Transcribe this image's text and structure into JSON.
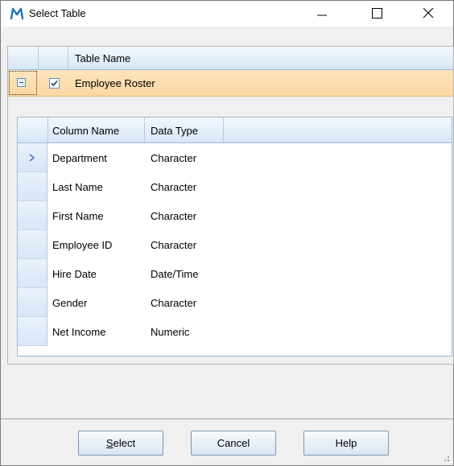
{
  "window": {
    "title": "Select Table",
    "app_icon": "letter-m-icon",
    "controls": [
      "minimize-icon",
      "maximize-icon",
      "close-icon"
    ]
  },
  "grid": {
    "header": {
      "col_label": "Table Name"
    },
    "master_row": {
      "name": "Employee Roster",
      "checked": true,
      "expanded": true
    },
    "detail": {
      "columns": [
        "Column Name",
        "Data Type"
      ],
      "rows": [
        {
          "column_name": "Department",
          "data_type": "Character",
          "current": true
        },
        {
          "column_name": "Last Name",
          "data_type": "Character"
        },
        {
          "column_name": "First Name",
          "data_type": "Character"
        },
        {
          "column_name": "Employee ID",
          "data_type": "Character"
        },
        {
          "column_name": "Hire Date",
          "data_type": "Date/Time"
        },
        {
          "column_name": "Gender",
          "data_type": "Character"
        },
        {
          "column_name": "Net Income",
          "data_type": "Numeric"
        }
      ]
    }
  },
  "buttons": {
    "select_accel": "S",
    "select_rest": "elect",
    "cancel": "Cancel",
    "help": "Help"
  },
  "colors": {
    "selected_row": "#fbd7a3",
    "header_gradient_bottom": "#d7e6f6",
    "app_icon": "#1e73be"
  }
}
